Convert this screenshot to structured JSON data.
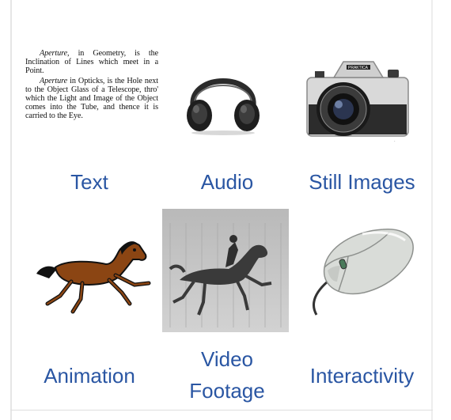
{
  "media_types": [
    {
      "label": "Text",
      "icon": "text-excerpt-image"
    },
    {
      "label": "Audio",
      "icon": "headphones-image"
    },
    {
      "label": "Still Images",
      "icon": "camera-image"
    },
    {
      "label": "Animation",
      "icon": "animated-horse-image"
    },
    {
      "label": "Video Footage",
      "icon": "galloping-horse-photo"
    },
    {
      "label": "Interactivity",
      "icon": "computer-mouse-image"
    }
  ],
  "text_excerpt": {
    "p1_italic": "Aperture",
    "p1_rest": ", in Geometry, is the Inclination of Lines which meet in a Point.",
    "p2_italic": "Aperture",
    "p2_rest": " in Opticks, is the Hole next to the Object Glass of a Telescope, thro' which the Light and Image of the Object comes into the Tube, and thence it is carried to the Eye."
  },
  "camera_brand": "PRAKTICA",
  "colors": {
    "label": "#2a56a3",
    "horse": "#8b4513"
  }
}
